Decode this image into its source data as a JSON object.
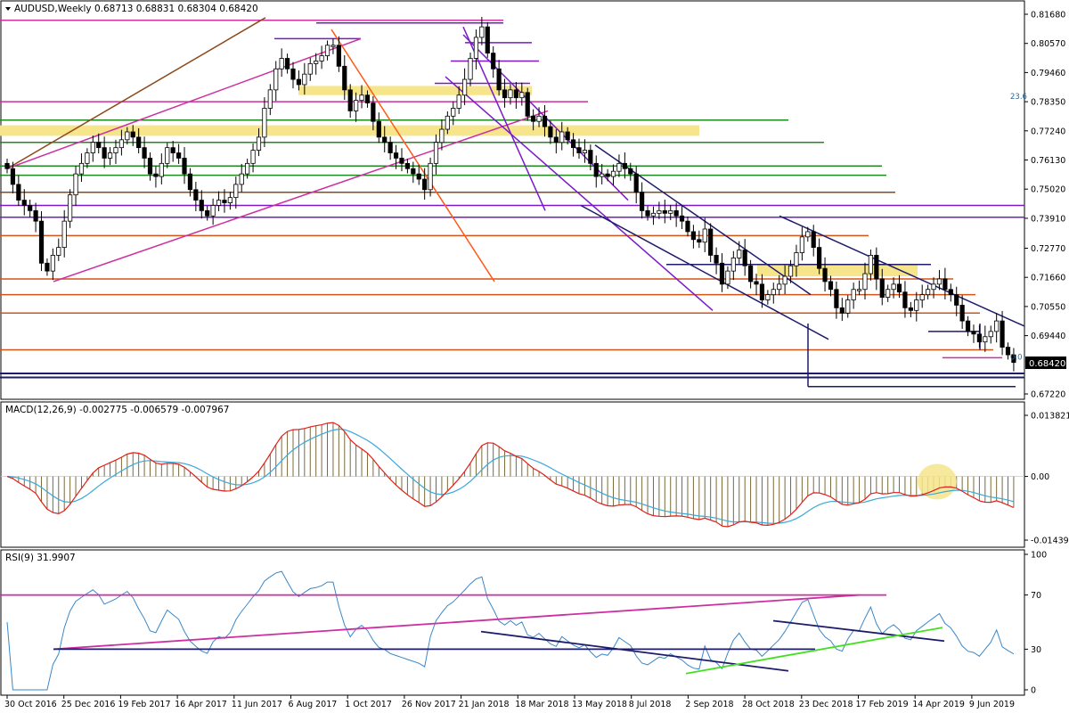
{
  "header": {
    "symbol_line": "AUDUSD,Weekly  0.68713 0.68831 0.68304 0.68420"
  },
  "colors": {
    "bull": "#ffffff",
    "bear": "#000000",
    "candle_outline": "#000000",
    "magenta": "#cc2fa0",
    "brown": "#8b4a1c",
    "orange": "#ff5a1a",
    "purple": "#7b19c9",
    "navy": "#1d1b6a",
    "green": "#1f8a1f",
    "darkorange": "#d2551a",
    "zone": "#f6e58a",
    "macd_hist": "#7a6a3a",
    "macd_main": "#e0201a",
    "macd_signal": "#3aa9d8",
    "rsi_line": "#3a87c8",
    "lime": "#44e020",
    "price_box": "#000000"
  },
  "chart_data": [
    {
      "type": "candlestick",
      "name": "price",
      "ylim": [
        0.6722,
        0.8168
      ],
      "y_ticks": [
        "0.81680",
        "0.80570",
        "0.79460",
        "0.78350",
        "0.77240",
        "0.76130",
        "0.75020",
        "0.73910",
        "0.72770",
        "0.71660",
        "0.70550",
        "0.69440",
        "0.68420",
        "0.67220"
      ],
      "y_tick_values": [
        0.8168,
        0.8057,
        0.7946,
        0.7835,
        0.7724,
        0.7613,
        0.7502,
        0.7391,
        0.7277,
        0.7166,
        0.7055,
        0.6944,
        0.6842,
        0.6722
      ],
      "current_price_label": "0.68420",
      "current_price": 0.6842,
      "fib_labels": [
        {
          "text": "23.6",
          "value": 0.7835
        },
        {
          "text": "0.0",
          "value": 0.6842
        }
      ],
      "x_tick_labels": [
        "30 Oct 2016",
        "25 Dec 2016",
        "19 Feb 2017",
        "16 Apr 2017",
        "11 Jun 2017",
        "6 Aug 2017",
        "1 Oct 2017",
        "26 Nov 2017",
        "21 Jan 2018",
        "18 Mar 2018",
        "13 May 2018",
        "8 Jul 2018",
        "2 Sep 2018",
        "28 Oct 2018",
        "23 Dec 2018",
        "17 Feb 2019",
        "14 Apr 2019",
        "9 Jun 2019"
      ],
      "close": [
        0.758,
        0.752,
        0.746,
        0.744,
        0.742,
        0.738,
        0.722,
        0.719,
        0.725,
        0.728,
        0.738,
        0.748,
        0.756,
        0.76,
        0.764,
        0.768,
        0.766,
        0.762,
        0.764,
        0.766,
        0.769,
        0.772,
        0.77,
        0.766,
        0.762,
        0.756,
        0.755,
        0.76,
        0.766,
        0.764,
        0.762,
        0.756,
        0.75,
        0.746,
        0.742,
        0.74,
        0.744,
        0.746,
        0.745,
        0.747,
        0.752,
        0.756,
        0.76,
        0.765,
        0.77,
        0.781,
        0.788,
        0.796,
        0.8,
        0.796,
        0.792,
        0.79,
        0.794,
        0.798,
        0.799,
        0.801,
        0.805,
        0.805,
        0.797,
        0.788,
        0.78,
        0.784,
        0.786,
        0.783,
        0.776,
        0.77,
        0.768,
        0.764,
        0.762,
        0.76,
        0.758,
        0.756,
        0.754,
        0.75,
        0.76,
        0.768,
        0.773,
        0.778,
        0.781,
        0.786,
        0.792,
        0.8,
        0.808,
        0.812,
        0.802,
        0.796,
        0.788,
        0.785,
        0.788,
        0.785,
        0.787,
        0.778,
        0.776,
        0.778,
        0.774,
        0.77,
        0.768,
        0.772,
        0.769,
        0.766,
        0.764,
        0.765,
        0.76,
        0.755,
        0.756,
        0.755,
        0.757,
        0.76,
        0.758,
        0.756,
        0.749,
        0.742,
        0.74,
        0.741,
        0.742,
        0.741,
        0.742,
        0.74,
        0.738,
        0.734,
        0.731,
        0.73,
        0.735,
        0.725,
        0.722,
        0.714,
        0.719,
        0.724,
        0.727,
        0.721,
        0.715,
        0.714,
        0.708,
        0.71,
        0.712,
        0.714,
        0.717,
        0.721,
        0.726,
        0.732,
        0.734,
        0.728,
        0.72,
        0.715,
        0.712,
        0.705,
        0.703,
        0.708,
        0.712,
        0.712,
        0.718,
        0.725,
        0.716,
        0.709,
        0.712,
        0.714,
        0.711,
        0.705,
        0.704,
        0.708,
        0.71,
        0.712,
        0.714,
        0.716,
        0.712,
        0.71,
        0.706,
        0.7,
        0.696,
        0.695,
        0.692,
        0.694,
        0.696,
        0.7,
        0.69,
        0.6871,
        0.6842
      ],
      "open": [
        0.76,
        0.758,
        0.752,
        0.746,
        0.744,
        0.742,
        0.738,
        0.722,
        0.719,
        0.725,
        0.728,
        0.738,
        0.748,
        0.756,
        0.76,
        0.764,
        0.768,
        0.766,
        0.762,
        0.764,
        0.766,
        0.769,
        0.772,
        0.77,
        0.766,
        0.762,
        0.756,
        0.755,
        0.76,
        0.766,
        0.764,
        0.762,
        0.756,
        0.75,
        0.746,
        0.742,
        0.74,
        0.744,
        0.746,
        0.745,
        0.747,
        0.752,
        0.756,
        0.76,
        0.765,
        0.77,
        0.781,
        0.788,
        0.796,
        0.8,
        0.796,
        0.792,
        0.79,
        0.794,
        0.798,
        0.799,
        0.801,
        0.805,
        0.805,
        0.797,
        0.788,
        0.78,
        0.784,
        0.786,
        0.783,
        0.776,
        0.77,
        0.768,
        0.764,
        0.762,
        0.76,
        0.758,
        0.756,
        0.754,
        0.75,
        0.76,
        0.768,
        0.773,
        0.778,
        0.781,
        0.786,
        0.792,
        0.8,
        0.808,
        0.812,
        0.802,
        0.796,
        0.788,
        0.785,
        0.788,
        0.785,
        0.787,
        0.778,
        0.776,
        0.778,
        0.774,
        0.77,
        0.768,
        0.772,
        0.769,
        0.766,
        0.764,
        0.765,
        0.76,
        0.755,
        0.756,
        0.755,
        0.757,
        0.76,
        0.758,
        0.756,
        0.749,
        0.742,
        0.74,
        0.741,
        0.742,
        0.741,
        0.742,
        0.74,
        0.738,
        0.734,
        0.731,
        0.73,
        0.735,
        0.725,
        0.722,
        0.714,
        0.719,
        0.724,
        0.727,
        0.721,
        0.715,
        0.714,
        0.708,
        0.71,
        0.712,
        0.714,
        0.717,
        0.721,
        0.726,
        0.732,
        0.734,
        0.728,
        0.72,
        0.715,
        0.712,
        0.705,
        0.703,
        0.708,
        0.712,
        0.712,
        0.718,
        0.725,
        0.716,
        0.709,
        0.712,
        0.714,
        0.711,
        0.705,
        0.704,
        0.708,
        0.71,
        0.712,
        0.714,
        0.716,
        0.712,
        0.71,
        0.706,
        0.7,
        0.696,
        0.695,
        0.692,
        0.694,
        0.696,
        0.7,
        0.69,
        0.6871
      ]
    },
    {
      "type": "line",
      "name": "macd",
      "title": "MACD(12,26,9) -0.002775 -0.006579 -0.007967",
      "ylim": [
        -0.014396,
        0.013821
      ],
      "y_ticks": [
        "0.013821",
        "0.00",
        "-0.014396"
      ],
      "y_tick_values": [
        0.013821,
        0.0,
        -0.014396
      ]
    },
    {
      "type": "line",
      "name": "rsi",
      "title": "RSI(9) 31.9907",
      "ylim": [
        0,
        100
      ],
      "y_ticks": [
        "100",
        "70",
        "30",
        "0"
      ],
      "y_tick_values": [
        100,
        70,
        30,
        0
      ]
    }
  ]
}
